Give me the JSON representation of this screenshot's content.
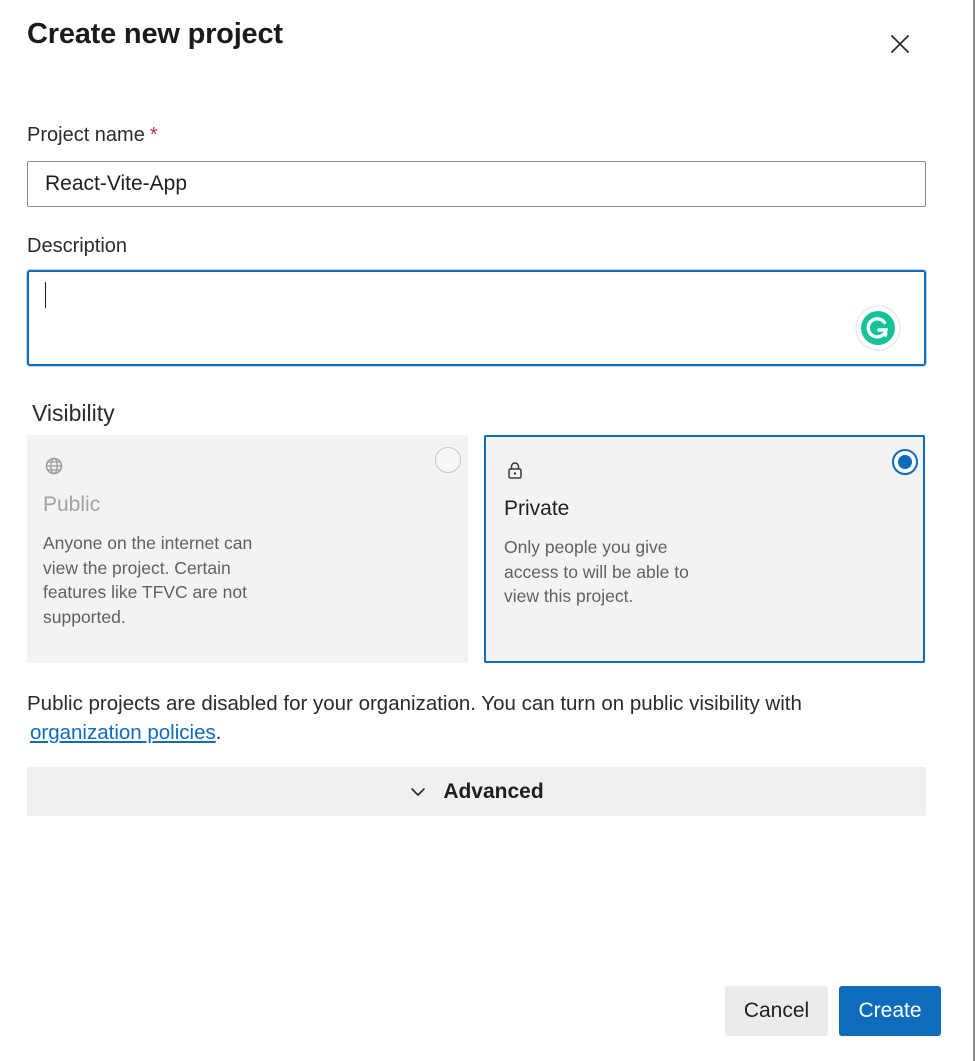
{
  "dialog": {
    "title": "Create new project",
    "close_icon": "close-icon"
  },
  "project_name": {
    "label": "Project name",
    "required_mark": "*",
    "value": "React-Vite-App"
  },
  "description": {
    "label": "Description",
    "value": "",
    "assistant_icon": "grammarly-icon"
  },
  "visibility": {
    "label": "Visibility",
    "options": [
      {
        "icon": "globe-icon",
        "title": "Public",
        "description": "Anyone on the internet can view the project. Certain features like TFVC are not supported.",
        "selected": false,
        "disabled": true
      },
      {
        "icon": "lock-icon",
        "title": "Private",
        "description": "Only people you give access to will be able to view this project.",
        "selected": true,
        "disabled": false
      }
    ]
  },
  "notice": {
    "text": "Public projects are disabled for your organization. You can turn on public visibility with",
    "link": "organization policies",
    "suffix": "."
  },
  "advanced": {
    "label": "Advanced",
    "icon": "chevron-down-icon"
  },
  "footer": {
    "cancel_label": "Cancel",
    "create_label": "Create"
  },
  "colors": {
    "accent": "#0f6cbd",
    "required": "#c4314b",
    "card_background": "#f3f3f3",
    "grammarly": "#15c39a"
  }
}
